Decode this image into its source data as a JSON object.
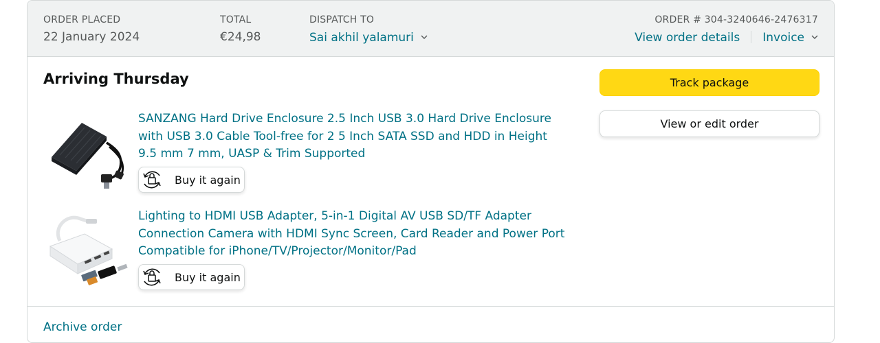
{
  "header": {
    "order_placed": {
      "label": "ORDER PLACED",
      "value": "22 January 2024"
    },
    "total": {
      "label": "TOTAL",
      "value": "€24,98"
    },
    "dispatch_to": {
      "label": "DISPATCH TO",
      "value": "Sai akhil yalamuri",
      "icon": "chevron-down-icon"
    },
    "order_number": {
      "label": "ORDER # 304-3240646-2476317"
    },
    "view_order_details": "View order details",
    "invoice": "Invoice"
  },
  "shipment": {
    "status": "Arriving Thursday",
    "items": [
      {
        "title": "SANZANG Hard Drive Enclosure 2.5 Inch USB 3.0 Hard Drive Enclosure with USB 3.0 Cable Tool-free for 2 5 Inch SATA SSD and HDD in Height 9.5 mm 7 mm, UASP & Trim Supported",
        "buy_again": "Buy it again",
        "image": "hard-drive-enclosure-image"
      },
      {
        "title": "Lighting to HDMI USB Adapter, 5-in-1 Digital AV USB SD/TF Adapter Connection Camera with HDMI Sync Screen, Card Reader and Power Port Compatible for iPhone/TV/Projector/Monitor/Pad",
        "buy_again": "Buy it again",
        "image": "hdmi-adapter-image"
      }
    ]
  },
  "actions": {
    "track_package": "Track package",
    "view_edit_order": "View or edit order"
  },
  "footer": {
    "archive_order": "Archive order"
  },
  "colors": {
    "link": "#007185",
    "header_bg": "#f0f2f2",
    "border": "#d5d9d9",
    "primary_button": "#ffd814",
    "text": "#0f1111",
    "muted_text": "#565959"
  }
}
